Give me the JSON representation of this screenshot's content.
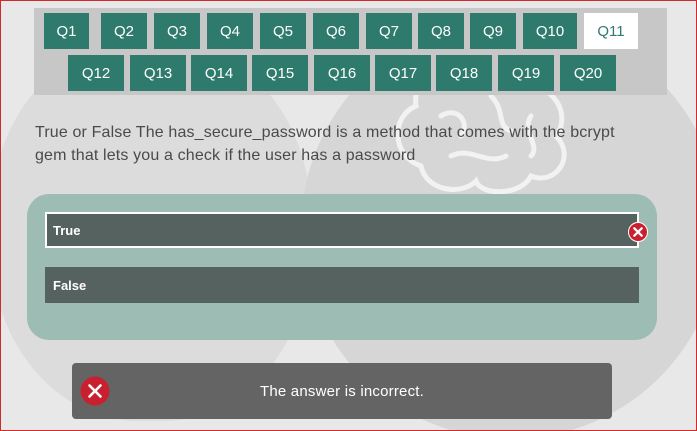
{
  "question_nav": {
    "current": "Q11",
    "row1": [
      "Q1",
      "Q2",
      "Q3",
      "Q4",
      "Q5",
      "Q6",
      "Q7",
      "Q8",
      "Q9",
      "Q10",
      "Q11"
    ],
    "row2": [
      "Q12",
      "Q13",
      "Q14",
      "Q15",
      "Q16",
      "Q17",
      "Q18",
      "Q19",
      "Q20"
    ]
  },
  "question": {
    "text": "True or False The has_secure_password is a method that comes with the bcrypt gem that lets you a check if the user has a password"
  },
  "answers": {
    "options": [
      {
        "label": "True",
        "selected": true,
        "status": "incorrect"
      },
      {
        "label": "False",
        "selected": false
      }
    ]
  },
  "feedback": {
    "message": "The answer is incorrect.",
    "icon": "x-circle-icon"
  },
  "colors": {
    "accent": "#2e7a6c",
    "answer_panel": "#9dbcb3",
    "option_bg": "#56625f",
    "error": "#c8202f",
    "feedback_bg": "#646464"
  }
}
